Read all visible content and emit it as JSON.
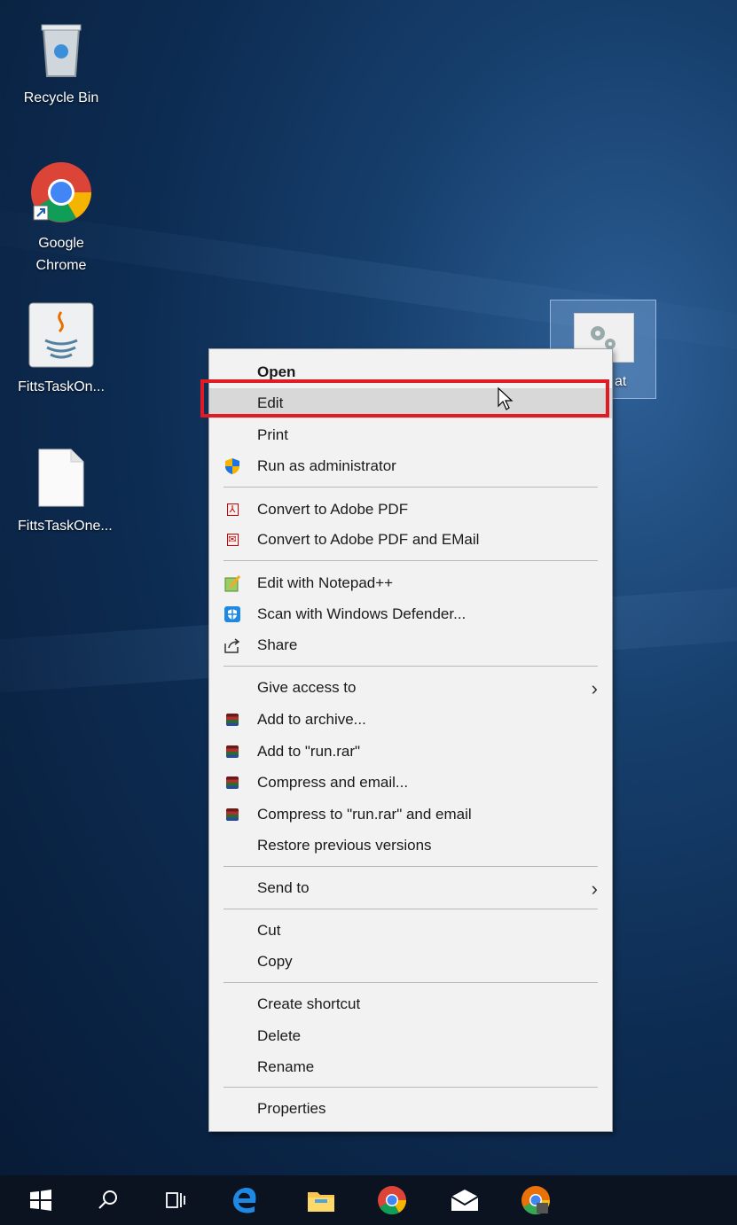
{
  "desktop": {
    "icons": [
      {
        "label": "Recycle Bin",
        "icon": "recycle-bin-icon"
      },
      {
        "label": "Google\nChrome",
        "icon": "chrome-icon"
      },
      {
        "label": "FittsTaskOn...",
        "icon": "java-icon"
      },
      {
        "label": "FittsTaskOne...",
        "icon": "file-icon"
      }
    ],
    "selected_icon": {
      "label": "at",
      "icon": "batch-file-gear-icon"
    }
  },
  "context_menu": {
    "items": {
      "open": "Open",
      "edit": "Edit",
      "print": "Print",
      "run_as_admin": "Run as administrator",
      "convert_pdf": "Convert to Adobe PDF",
      "convert_pdf_email": "Convert to Adobe PDF and EMail",
      "edit_notepad": "Edit with Notepad++",
      "scan_defender": "Scan with Windows Defender...",
      "share": "Share",
      "give_access": "Give access to",
      "add_archive": "Add to archive...",
      "add_rar": "Add to \"run.rar\"",
      "compress_email": "Compress and email...",
      "compress_rar_email": "Compress to \"run.rar\" and email",
      "restore": "Restore previous versions",
      "send_to": "Send to",
      "cut": "Cut",
      "copy": "Copy",
      "create_shortcut": "Create shortcut",
      "delete": "Delete",
      "rename": "Rename",
      "properties": "Properties"
    }
  },
  "taskbar": {
    "items": [
      "start-icon",
      "search-icon",
      "task-view-icon",
      "edge-icon",
      "file-explorer-icon",
      "chrome-icon",
      "mail-icon",
      "chrome-canary-icon"
    ]
  },
  "colors": {
    "highlight": "#e01b24",
    "menu_bg": "#f2f2f2",
    "taskbar_bg": "#0b1320"
  }
}
